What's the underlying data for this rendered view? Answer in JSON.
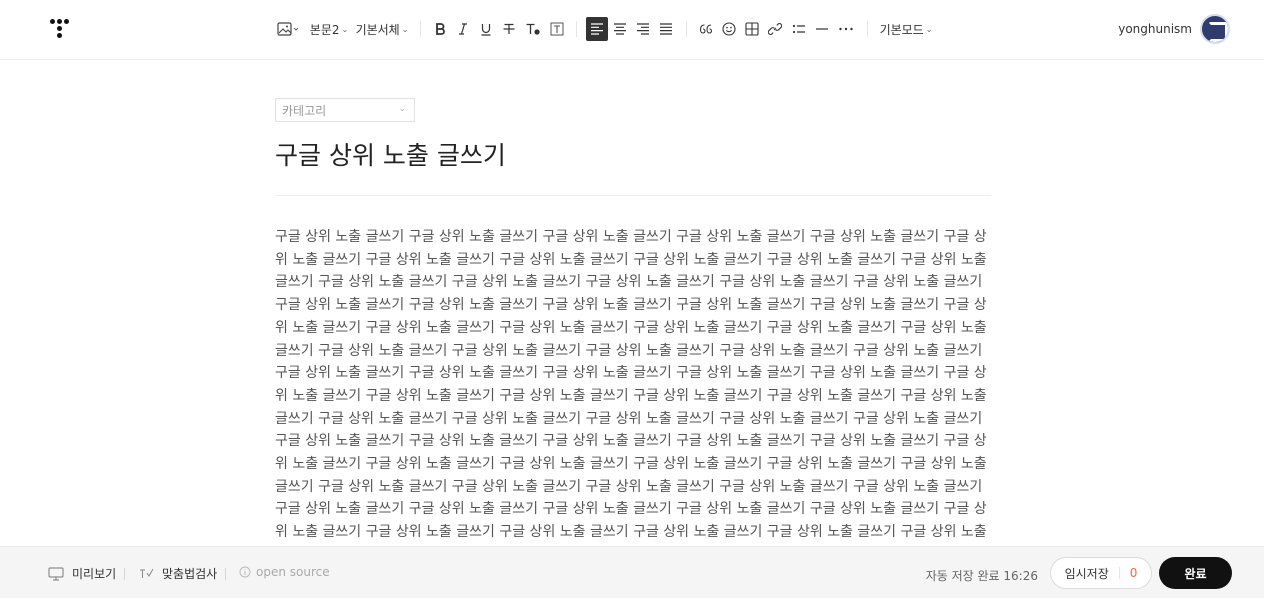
{
  "toolbar": {
    "paragraph_style": "본문2",
    "font": "기본서체",
    "mode": "기본모드"
  },
  "user": {
    "name": "yonghunism"
  },
  "editor": {
    "category_placeholder": "카테고리",
    "title": "구글 상위 노출 글쓰기",
    "body": "구글 상위 노출 글쓰기 구글 상위 노출 글쓰기 구글 상위 노출 글쓰기 구글 상위 노출 글쓰기 구글 상위 노출 글쓰기 구글 상위 노출 글쓰기 구글 상위 노출 글쓰기 구글 상위 노출 글쓰기 구글 상위 노출 글쓰기 구글 상위 노출 글쓰기 구글 상위 노출 글쓰기 구글 상위 노출 글쓰기 구글 상위 노출 글쓰기 구글 상위 노출 글쓰기 구글 상위 노출 글쓰기 구글 상위 노출 글쓰기 구글 상위 노출 글쓰기 구글 상위 노출 글쓰기 구글 상위 노출 글쓰기 구글 상위 노출 글쓰기 구글 상위 노출 글쓰기 구글 상위 노출 글쓰기 구글 상위 노출 글쓰기 구글 상위 노출 글쓰기 구글 상위 노출 글쓰기 구글 상위 노출 글쓰기 구글 상위 노출 글쓰기 구글 상위 노출 글쓰기 구글 상위 노출 글쓰기 구글 상위 노출 글쓰기 구글 상위 노출 글쓰기 구글 상위 노출 글쓰기 구글 상위 노출 글쓰기 구글 상위 노출 글쓰기 구글 상위 노출 글쓰기 구글 상위 노출 글쓰기 구글 상위 노출 글쓰기 구글 상위 노출 글쓰기 구글 상위 노출 글쓰기 구글 상위 노출 글쓰기 구글 상위 노출 글쓰기 구글 상위 노출 글쓰기 구글 상위 노출 글쓰기 구글 상위 노출 글쓰기 구글 상위 노출 글쓰기 구글 상위 노출 글쓰기 구글 상위 노출 글쓰기 구글 상위 노출 글쓰기 구글 상위 노출 글쓰기 구글 상위 노출 글쓰기 구글 상위 노출 글쓰기 구글 상위 노출 글쓰기 구글 상위 노출 글쓰기 구글 상위 노출 글쓰기 구글 상위 노출 글쓰기 구글 상위 노출 글쓰기 구글 상위 노출 글쓰기 구글 상위 노출 글쓰기 구글 상위 노출 글쓰기 구글 상위 노출 글쓰기 구글 상위 노출 글쓰기 구글 상위 노출 글쓰기 구글 상위 노출 글쓰기 구글 상위 노출 글쓰기 구글 상위 노출 글쓰기 구글 상위 노출 글쓰기 구글 상위 노출 글쓰기 구글 상위 노출 글쓰기 구글 상위 노출 글쓰기 구글 상위 노출 글쓰기 구글 상위 노출 글쓰기 구글 상위 노출 글쓰기 구글 상위 노출 글쓰기 구글 상위 노출 글쓰기 구글 상위 노출 글쓰기 구글 상위 노출 글쓰기"
  },
  "bottom": {
    "preview_label": "미리보기",
    "spellcheck_label": "맞춤법검사",
    "open_source_label": "open source",
    "autosave_status": "자동 저장 완료 16:26",
    "draft_label": "임시저장",
    "draft_count": "0",
    "done_label": "완료"
  },
  "colors": {
    "accent_dark": "#111111",
    "draft_count": "#f36b3b",
    "bottom_bar": "#f5f5f5"
  }
}
